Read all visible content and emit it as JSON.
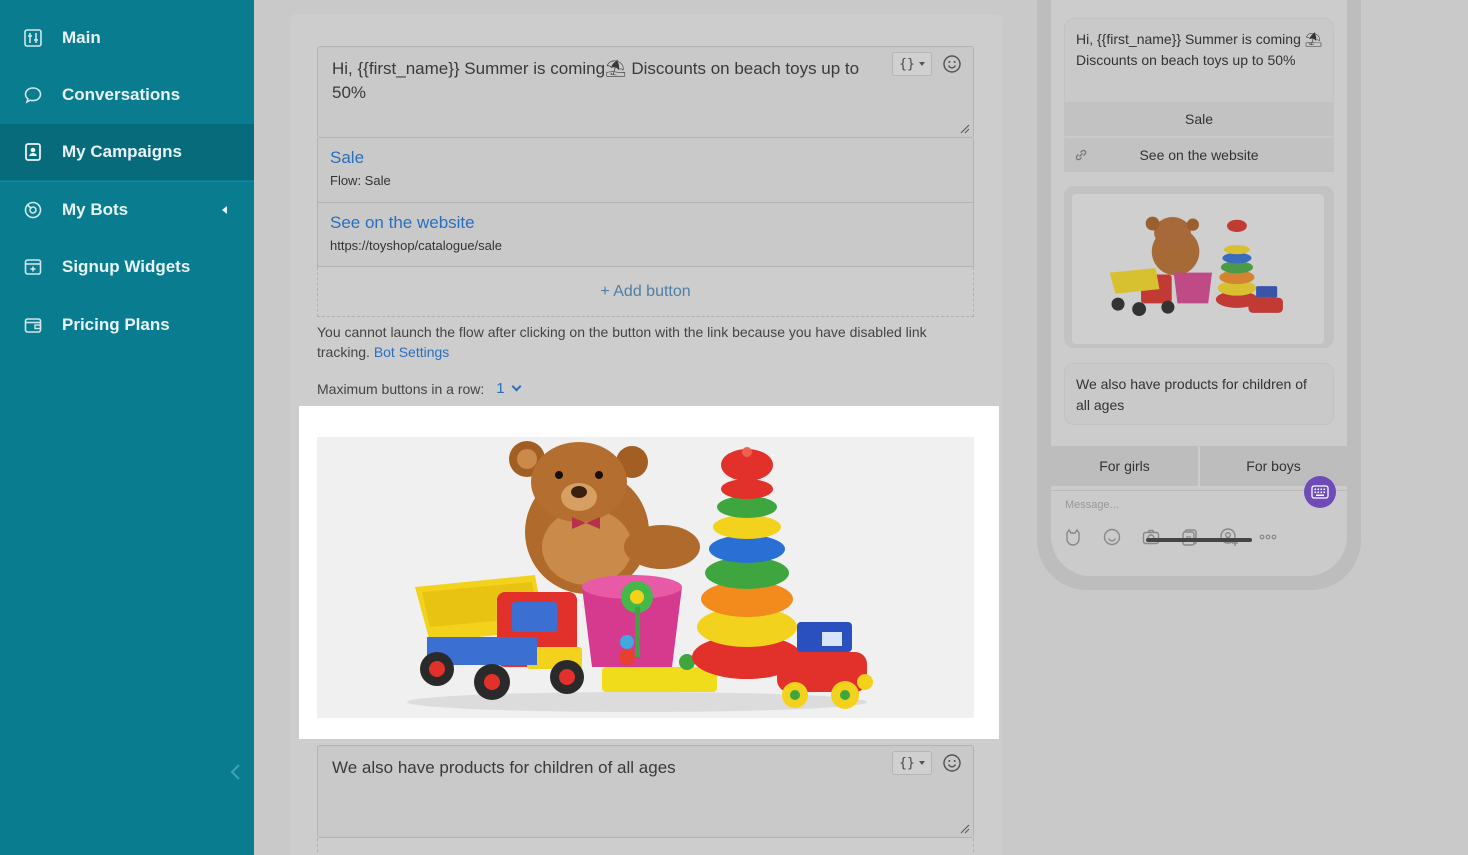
{
  "sidebar": {
    "items": [
      {
        "label": "Main",
        "icon": "main-icon"
      },
      {
        "label": "Conversations",
        "icon": "chat-icon"
      },
      {
        "label": "My Campaigns",
        "icon": "campaigns-icon",
        "active": true
      },
      {
        "label": "My Bots",
        "icon": "bots-icon"
      },
      {
        "label": "Signup Widgets",
        "icon": "widgets-icon"
      },
      {
        "label": "Pricing Plans",
        "icon": "wallet-icon"
      }
    ],
    "colors": {
      "background": "#0a7c8f",
      "active": "#086b7c"
    }
  },
  "editor": {
    "message1": {
      "text": "Hi,  {{first_name}} Summer is coming⛱ Discounts on beach toys up to 50%",
      "var_button": "{}"
    },
    "buttons": [
      {
        "label": "Sale",
        "sub": "Flow: Sale"
      },
      {
        "label": "See on the website",
        "sub": "https://toyshop/catalogue/sale"
      }
    ],
    "add_button": "+ Add button",
    "notice": "You cannot launch the flow after clicking on the button with the link because you have disabled link tracking.",
    "notice_link": "Bot Settings",
    "max_row_label": "Maximum buttons in a row:",
    "max_row_value": "1",
    "message2": {
      "text": "We also have products for children of all ages",
      "var_button": "{}"
    }
  },
  "preview": {
    "message1": "Hi,  {{first_name}} Summer is coming ⛱ Discounts on beach toys up to 50%",
    "btn1": "Sale",
    "btn2": "See on the website",
    "message2": "We also have products for children of all ages",
    "quick_replies": [
      "For girls",
      "For boys"
    ],
    "message_placeholder": "Message...",
    "accent": "#6f4bb8"
  }
}
